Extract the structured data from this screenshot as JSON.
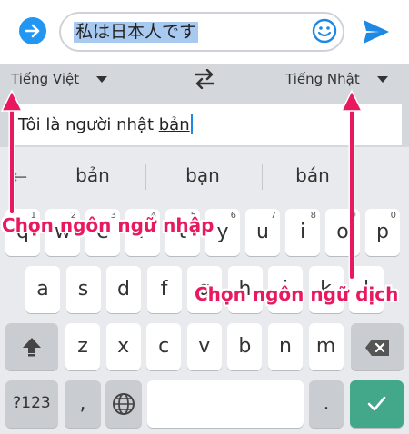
{
  "compose": {
    "message": "私は日本人です",
    "icons": [
      "arrow-forward-circle-icon",
      "emoji-icon",
      "send-icon"
    ]
  },
  "translator": {
    "source_lang": "Tiếng Việt",
    "target_lang": "Tiếng Nhật",
    "input_before": "Tôi là người nhật ",
    "input_underlined": "bản"
  },
  "suggestions": [
    "bản",
    "bạn",
    "bán"
  ],
  "keyboard": {
    "row1": [
      {
        "k": "q",
        "n": "1"
      },
      {
        "k": "w",
        "n": "2"
      },
      {
        "k": "e",
        "n": "3"
      },
      {
        "k": "r",
        "n": "4"
      },
      {
        "k": "t",
        "n": "5"
      },
      {
        "k": "y",
        "n": "6"
      },
      {
        "k": "u",
        "n": "7"
      },
      {
        "k": "i",
        "n": "8"
      },
      {
        "k": "o",
        "n": "9"
      },
      {
        "k": "p",
        "n": "0"
      }
    ],
    "row2": [
      "a",
      "s",
      "d",
      "f",
      "g",
      "h",
      "j",
      "k",
      "l"
    ],
    "row3": [
      "z",
      "x",
      "c",
      "v",
      "b",
      "n",
      "m"
    ],
    "row4": {
      "sym": "?123",
      "comma": ",",
      "period": "."
    }
  },
  "annotations": {
    "input_lang": "Chọn ngôn ngữ nhập",
    "target_lang": "Chọn ngôn ngữ dịch",
    "color": "#e8195f"
  }
}
